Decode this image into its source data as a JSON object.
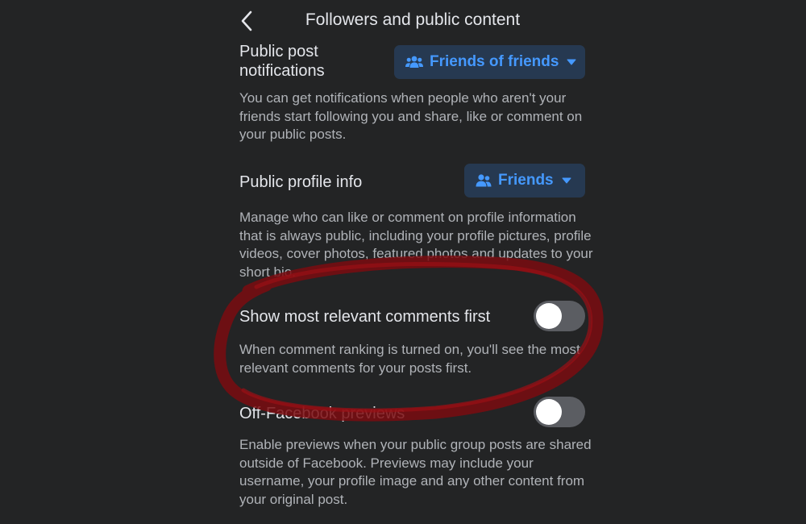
{
  "header": {
    "title": "Followers and public content"
  },
  "settings": {
    "public_post": {
      "title_line1": "Public post",
      "title_line2": "notifications",
      "dropdown_value": "Friends of friends",
      "description": "You can get notifications when people who aren't your friends start following you and share, like or comment on your public posts."
    },
    "public_profile": {
      "title": "Public profile info",
      "dropdown_value": "Friends",
      "description": "Manage who can like or comment on profile information that is always public, including your profile pictures, profile videos, cover photos, featured photos and updates to your short bio."
    },
    "comments_ranking": {
      "title": "Show most relevant comments first",
      "enabled": false,
      "description": "When comment ranking is turned on, you'll see the most relevant comments for your posts first."
    },
    "off_facebook_previews": {
      "title": "Off-Facebook previews",
      "enabled": false,
      "description": "Enable previews when your public group posts are shared outside of Facebook. Previews may include your username, your profile image and any other content from your original post."
    }
  },
  "colors": {
    "background": "#232425",
    "dropdown_bg": "#263951",
    "accent_blue": "#4599ff",
    "annotation_red": "#8b0d12"
  },
  "icons": {
    "back": "chevron-left-icon",
    "group": "group-people-icon",
    "friends": "friends-icon",
    "caret": "caret-down-icon"
  }
}
